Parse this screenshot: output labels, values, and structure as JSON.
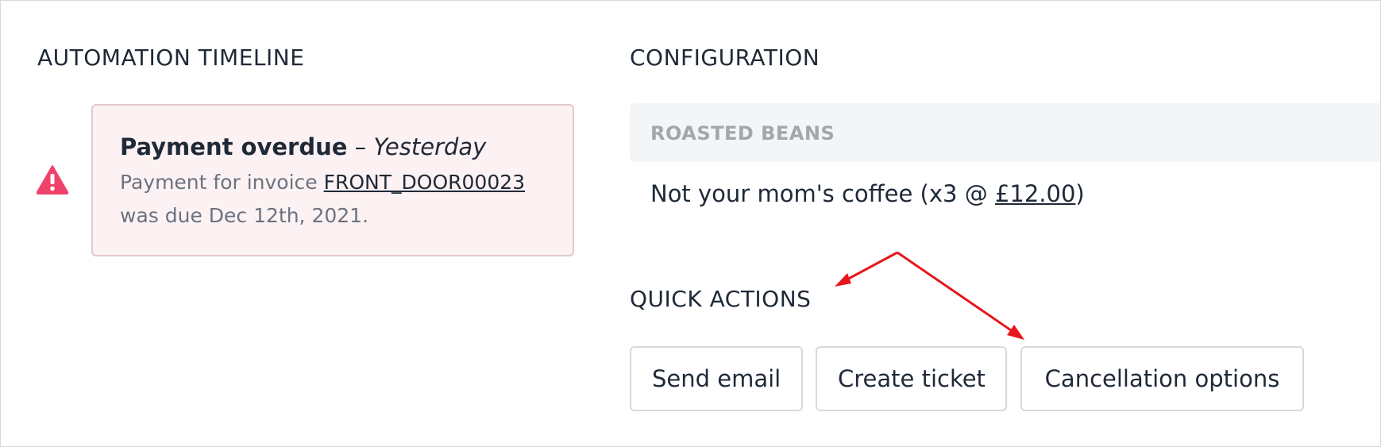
{
  "timeline": {
    "heading": "AUTOMATION TIMELINE",
    "alert": {
      "title": "Payment overdue",
      "separator": " – ",
      "when": "Yesterday",
      "body_prefix": "Payment for invoice ",
      "invoice_link": "FRONT_DOOR00023",
      "body_suffix": "was due Dec 12th, 2021.",
      "icon": "warning-triangle-icon",
      "icon_color": "#f0436b"
    }
  },
  "configuration": {
    "heading": "CONFIGURATION",
    "group_label": "ROASTED BEANS",
    "product": {
      "name": "Not your mom's coffee",
      "qty_prefix": " (x3 @ ",
      "price_link": "£12.00",
      "suffix": ")"
    }
  },
  "quick_actions": {
    "heading": "QUICK ACTIONS",
    "buttons": {
      "send_email": "Send email",
      "create_ticket": "Create ticket",
      "cancellation": "Cancellation options"
    }
  },
  "annotation": {
    "arrow_color": "#e8161c"
  }
}
